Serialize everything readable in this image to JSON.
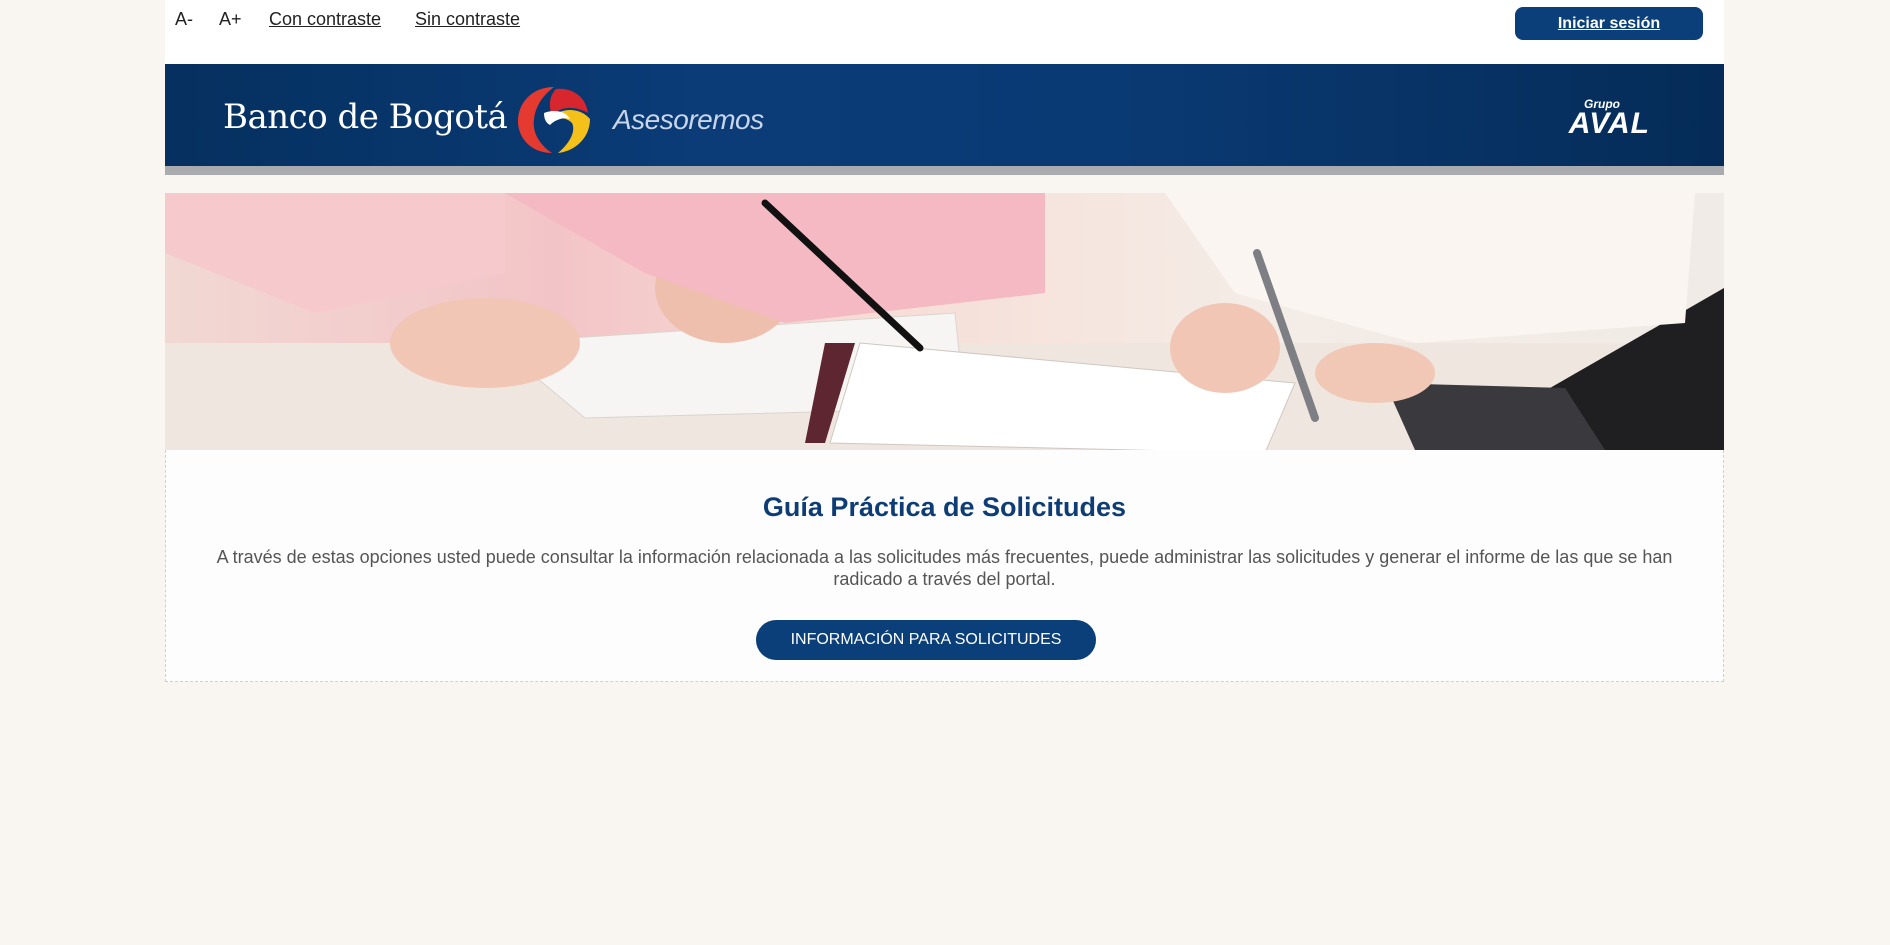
{
  "accessibility": {
    "decrease_font": "A-",
    "increase_font": "A+",
    "high_contrast": "Con contraste",
    "no_contrast": "Sin contraste"
  },
  "header": {
    "login_button": "Iniciar sesión",
    "bank_name": "Banco de Bogotá",
    "tagline": "Asesoremos",
    "group_prefix": "Grupo",
    "group_name": "AVAL",
    "brand_color": "#0a3f7a"
  },
  "hero": {
    "image": "people-signing-documents-photo"
  },
  "main": {
    "title": "Guía Práctica de Solicitudes",
    "description": "A través de estas opciones usted puede consultar la información relacionada a las solicitudes más frecuentes, puede administrar las solicitudes y generar el informe de las que se han radicado a través del portal.",
    "cta_button": "INFORMACIÓN PARA SOLICITUDES"
  }
}
